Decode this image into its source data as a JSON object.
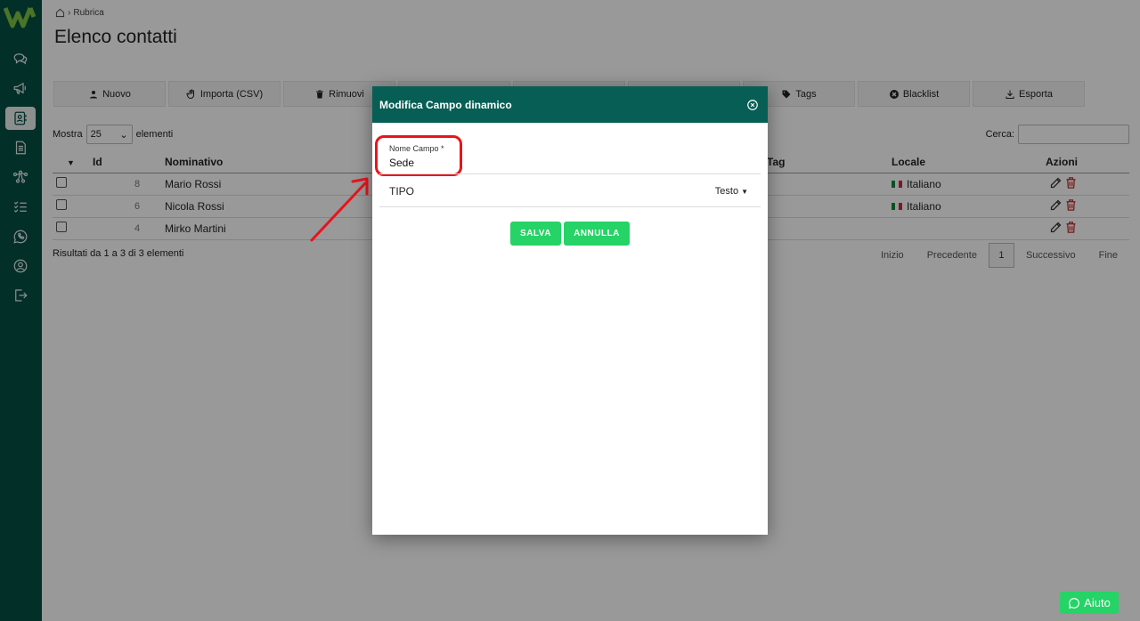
{
  "breadcrumb": {
    "home_icon": "home-icon",
    "current": "Rubrica"
  },
  "page": {
    "title": "Elenco contatti"
  },
  "sidebar": {
    "items": [
      {
        "icon": "chat-icon"
      },
      {
        "icon": "megaphone-icon"
      },
      {
        "icon": "contacts-icon",
        "active": true
      },
      {
        "icon": "document-icon"
      },
      {
        "icon": "flow-icon"
      },
      {
        "icon": "checklist-icon"
      },
      {
        "icon": "whatsapp-icon"
      },
      {
        "icon": "user-circle-icon"
      },
      {
        "icon": "logout-icon"
      }
    ]
  },
  "toolbar": {
    "nuovo": "Nuovo",
    "importa": "Importa (CSV)",
    "rimuovi": "Rimuovi",
    "tags": "Tags",
    "blacklist": "Blacklist",
    "esporta": "Esporta"
  },
  "list": {
    "show_prefix": "Mostra",
    "show_value": "25",
    "show_suffix": "elementi",
    "search_label": "Cerca:"
  },
  "table": {
    "headers": {
      "id": "Id",
      "nominativo": "Nominativo",
      "tag": "Tag",
      "locale": "Locale",
      "azioni": "Azioni"
    },
    "rows": [
      {
        "id": "8",
        "nominativo": "Mario Rossi",
        "locale": "Italiano"
      },
      {
        "id": "6",
        "nominativo": "Nicola Rossi",
        "locale": "Italiano"
      },
      {
        "id": "4",
        "nominativo": "Mirko Martini",
        "locale": ""
      }
    ]
  },
  "footer": {
    "results": "Risultati da 1 a 3 di 3 elementi"
  },
  "pager": {
    "first": "Inizio",
    "prev": "Precedente",
    "current": "1",
    "next": "Successivo",
    "last": "Fine"
  },
  "modal": {
    "title": "Modifica Campo dinamico",
    "field_label": "Nome Campo *",
    "field_value": "Sede",
    "type_label": "TIPO",
    "type_value": "Testo",
    "save": "SALVA",
    "cancel": "ANNULLA"
  },
  "help": {
    "label": "Aiuto"
  },
  "colors": {
    "brand": "#075e54",
    "accent": "#25d366",
    "highlight": "#e8141d"
  }
}
